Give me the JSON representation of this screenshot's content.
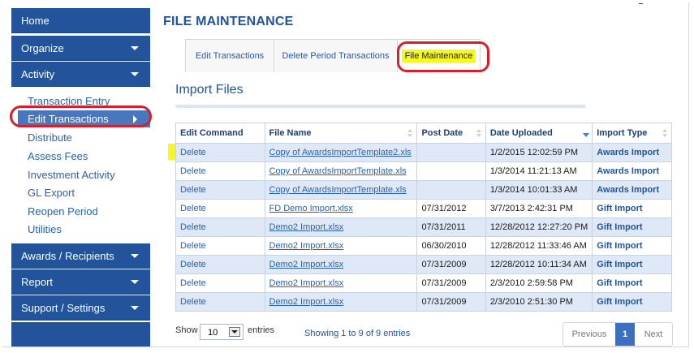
{
  "sidebar": {
    "home": "Home",
    "organize": "Organize",
    "activity": "Activity",
    "submenu": [
      "Transaction Entry",
      "Edit Transactions",
      "Distribute",
      "Assess Fees",
      "Investment Activity",
      "GL Export",
      "Reopen Period",
      "Utilities"
    ],
    "awards": "Awards / Recipients",
    "report": "Report",
    "support": "Support / Settings"
  },
  "page_title": "FILE MAINTENANCE",
  "tabs": [
    "Edit Transactions",
    "Delete Period Transactions",
    "File Maintenance"
  ],
  "section_title": "Import Files",
  "table": {
    "headers": [
      "Edit Command",
      "File Name",
      "Post Date",
      "Date Uploaded",
      "Import Type"
    ],
    "rows": [
      [
        "Delete",
        "Copy of AwardsImportTemplate2.xls",
        "",
        "1/2/2015 12:02:59 PM",
        "Awards Import"
      ],
      [
        "Delete",
        "Copy of AwardsImportTemplate.xls",
        "",
        "1/3/2014 11:21:13 AM",
        "Awards Import"
      ],
      [
        "Delete",
        "Copy of AwardsImportTemplate.xls",
        "",
        "1/3/2014 10:01:33 AM",
        "Awards Import"
      ],
      [
        "Delete",
        "FD Demo Import.xlsx",
        "07/31/2012",
        "3/7/2013 2:42:31 PM",
        "Gift Import"
      ],
      [
        "Delete",
        "Demo2 Import.xlsx",
        "07/31/2011",
        "12/28/2012 12:27:20 PM",
        "Gift Import"
      ],
      [
        "Delete",
        "Demo2 Import.xlsx",
        "06/30/2010",
        "12/28/2012 11:33:46 AM",
        "Gift Import"
      ],
      [
        "Delete",
        "Demo2 Import.xlsx",
        "07/31/2009",
        "12/28/2012 10:11:34 AM",
        "Gift Import"
      ],
      [
        "Delete",
        "Demo2 Import.xlsx",
        "07/31/2009",
        "2/3/2010 2:59:58 PM",
        "Gift Import"
      ],
      [
        "Delete",
        "Demo2 Import.xlsx",
        "07/31/2009",
        "2/3/2010 2:51:30 PM",
        "Gift Import"
      ]
    ]
  },
  "footer": {
    "show": "Show",
    "page_size": "10",
    "entries": "entries",
    "info": "Showing 1 to 9 of 9 entries",
    "previous": "Previous",
    "current_page": "1",
    "next": "Next"
  },
  "colors": {
    "nav_blue": "#23549b",
    "highlight_yellow": "#f6f71e",
    "annotation_red": "#d3202a",
    "row_stripe": "#dfe8f6"
  }
}
